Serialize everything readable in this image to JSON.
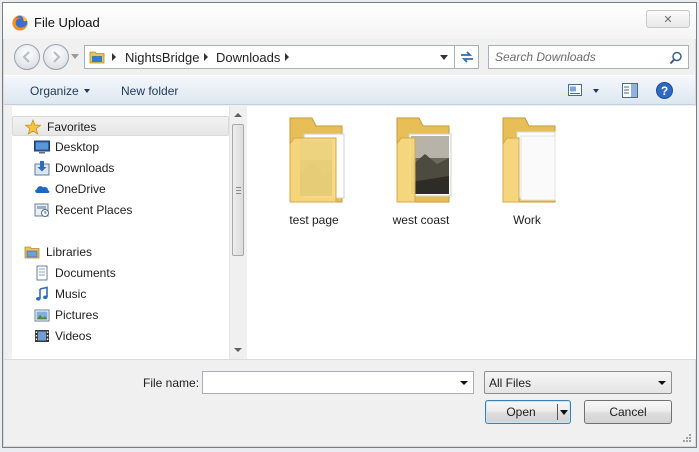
{
  "window": {
    "title": "File Upload",
    "close_label": "✕"
  },
  "address": {
    "crumbs": [
      "NightsBridge",
      "Downloads"
    ],
    "search_placeholder": "Search Downloads"
  },
  "toolbar": {
    "organize_label": "Organize",
    "new_folder_label": "New folder"
  },
  "nav": {
    "favorites": {
      "label": "Favorites",
      "items": [
        {
          "label": "Desktop",
          "icon": "desktop-icon"
        },
        {
          "label": "Downloads",
          "icon": "downloads-icon"
        },
        {
          "label": "OneDrive",
          "icon": "onedrive-icon"
        },
        {
          "label": "Recent Places",
          "icon": "recent-places-icon"
        }
      ]
    },
    "libraries": {
      "label": "Libraries",
      "items": [
        {
          "label": "Documents",
          "icon": "documents-icon"
        },
        {
          "label": "Music",
          "icon": "music-icon"
        },
        {
          "label": "Pictures",
          "icon": "pictures-icon"
        },
        {
          "label": "Videos",
          "icon": "videos-icon"
        }
      ]
    }
  },
  "content": {
    "folders": [
      {
        "name": "test page",
        "icon": "folder-with-photos-icon"
      },
      {
        "name": "west coast",
        "icon": "folder-with-photos-icon"
      },
      {
        "name": "Work",
        "icon": "folder-icon"
      }
    ]
  },
  "footer": {
    "file_name_label": "File name:",
    "file_name_value": "",
    "file_type_selected": "All Files",
    "open_label": "Open",
    "cancel_label": "Cancel"
  },
  "colors": {
    "toolbar_text": "#1e395b",
    "folder_yellow": "#f2d27a",
    "accent_blue": "#3c7fb1"
  }
}
